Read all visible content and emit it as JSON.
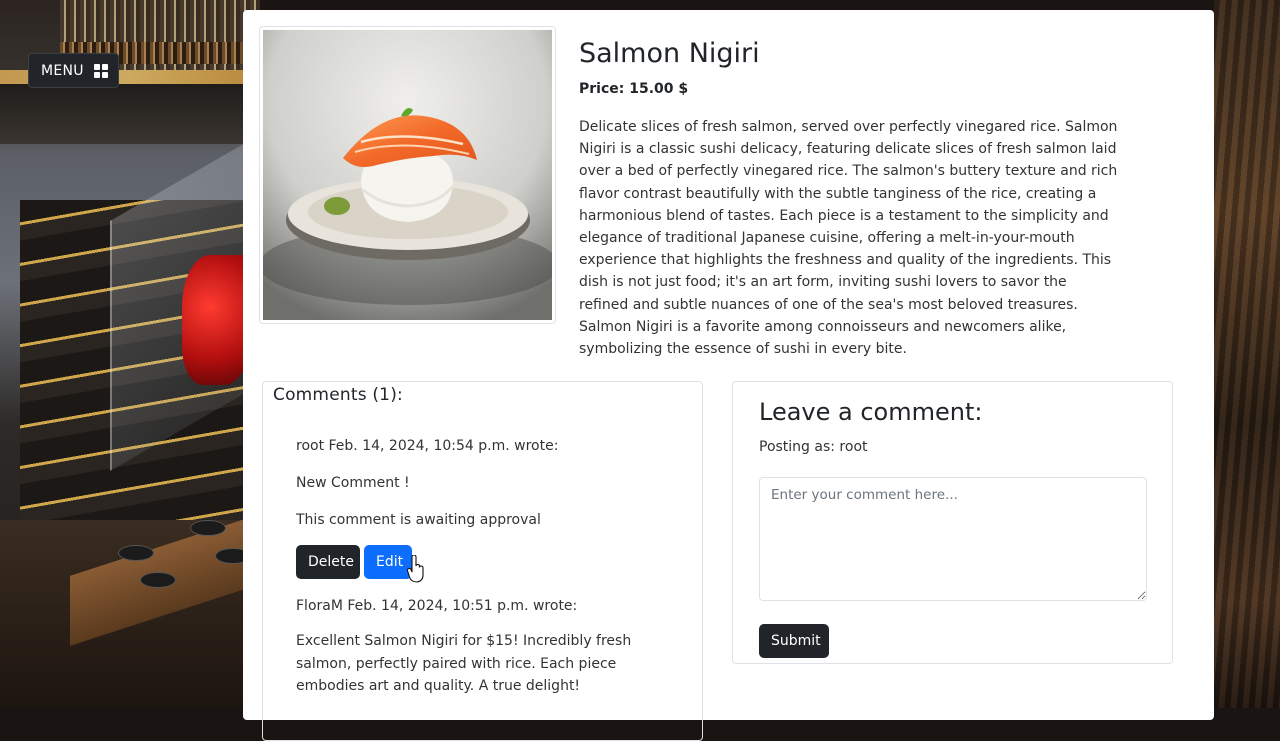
{
  "nav": {
    "menu_label": "MENU"
  },
  "item": {
    "name": "Salmon Nigiri",
    "price": "Price: 15.00 $",
    "description": "Delicate slices of fresh salmon, served over perfectly vinegared rice. Salmon Nigiri is a classic sushi delicacy, featuring delicate slices of fresh salmon laid over a bed of perfectly vinegared rice. The salmon's buttery texture and rich flavor contrast beautifully with the subtle tanginess of the rice, creating a harmonious blend of tastes. Each piece is a testament to the simplicity and elegance of traditional Japanese cuisine, offering a melt-in-your-mouth experience that highlights the freshness and quality of the ingredients. This dish is not just food; it's an art form, inviting sushi lovers to savor the refined and subtle nuances of one of the sea's most beloved treasures. Salmon Nigiri is a favorite among connoisseurs and newcomers alike, symbolizing the essence of sushi in every bite."
  },
  "comments": {
    "heading": "Comments (1):",
    "list": [
      {
        "header": "root Feb. 14, 2024, 10:54 p.m. wrote:",
        "body": "New Comment !",
        "status": "This comment is awaiting approval",
        "delete_label": "Delete",
        "edit_label": "Edit"
      },
      {
        "header": "FloraM Feb. 14, 2024, 10:51 p.m. wrote:",
        "body": "Excellent Salmon Nigiri for $15! Incredibly fresh salmon, perfectly paired with rice. Each piece embodies art and quality. A true delight!"
      }
    ]
  },
  "leave_comment": {
    "heading": "Leave a comment:",
    "posting_as": "Posting as: root",
    "placeholder": "Enter your comment here...",
    "submit_label": "Submit"
  },
  "colors": {
    "dark": "#212529",
    "primary": "#0d6efd",
    "border": "#dee2e6"
  }
}
